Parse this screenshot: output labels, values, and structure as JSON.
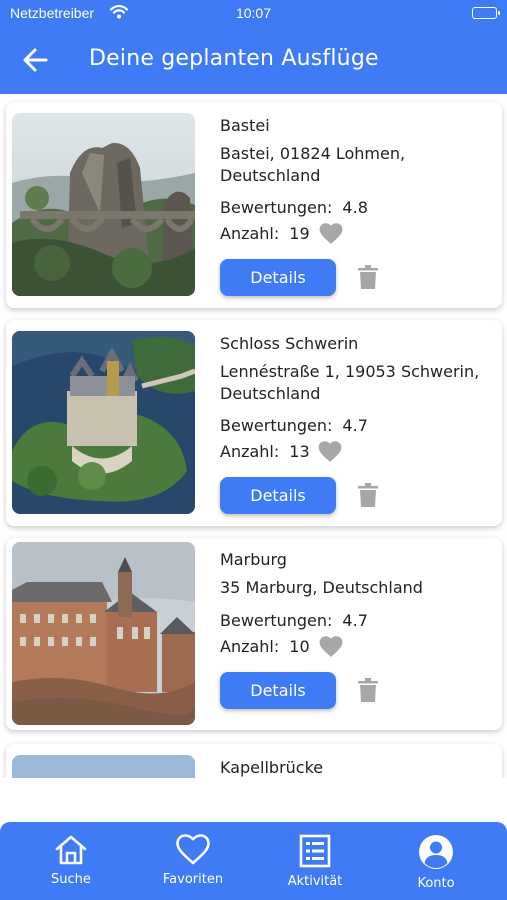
{
  "status_bar": {
    "carrier": "Netzbetreiber",
    "time": "10:07"
  },
  "header": {
    "title": "Deine  geplanten Ausflüge"
  },
  "labels": {
    "ratings": "Bewertungen:",
    "count": "Anzahl:",
    "details": "Details"
  },
  "trips": [
    {
      "name": "Bastei",
      "address": "Bastei, 01824 Lohmen, Deutschland",
      "rating": "4.8",
      "count": "19"
    },
    {
      "name": "Schloss Schwerin",
      "address": "Lennéstraße 1, 19053 Schwerin, Deutschland",
      "rating": "4.7",
      "count": "13"
    },
    {
      "name": "Marburg",
      "address": "35 Marburg, Deutschland",
      "rating": "4.7",
      "count": "10"
    },
    {
      "name": "Kapellbrücke"
    }
  ],
  "tabs": [
    {
      "label": "Suche",
      "icon": "home-icon"
    },
    {
      "label": "Favoriten",
      "icon": "heart-outline-icon"
    },
    {
      "label": "Aktivität",
      "icon": "list-icon"
    },
    {
      "label": "Konto",
      "icon": "account-icon"
    }
  ],
  "colors": {
    "primary": "#3f7bf5",
    "icon_grey": "#a7a7a7",
    "background": "#ffffff"
  }
}
